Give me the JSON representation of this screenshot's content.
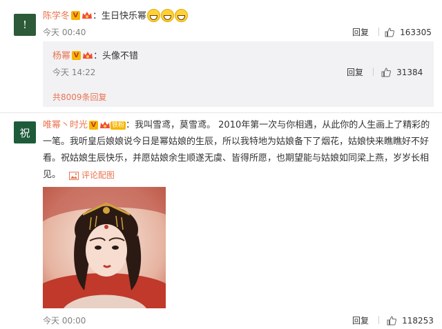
{
  "comment1": {
    "author": "陈学冬",
    "text": "：生日快乐幂",
    "time": "今天 00:40",
    "reply_label": "回复",
    "likes": "163305",
    "avatar_text": "!",
    "avatar_color": "#2d5a38"
  },
  "reply1": {
    "author": "杨幂",
    "text": "：头像不错",
    "time": "今天 14:22",
    "reply_label": "回复",
    "likes": "31384",
    "more_replies": "共8009条回复"
  },
  "comment2": {
    "author": "唯幂丶时光",
    "fan_badge": "铁粉",
    "text_line1": "：我叫雪鸢，莫雪鸢。 2010年第一次与你相遇，从此你的人生画上了精彩的",
    "text_line2": "一笔。我听皇后娘娘说今日是幂姑娘的生辰，所以我特地为姑娘备下了烟花，姑娘快来瞧瞧好不好",
    "text_line3": "看。祝姑娘生辰快乐，并愿姑娘余生顺遂无虞、皆得所愿，也期望能与姑娘如同梁上燕，岁岁长相",
    "text_line4": "见。",
    "image_link": "评论配图",
    "time": "今天 00:00",
    "reply_label": "回复",
    "likes": "118253",
    "avatar_text": "祝",
    "avatar_color": "#1e5b3a"
  },
  "colors": {
    "name": "#eb7350",
    "link": "#eb7350",
    "reply_bg": "#f2f2f5"
  }
}
